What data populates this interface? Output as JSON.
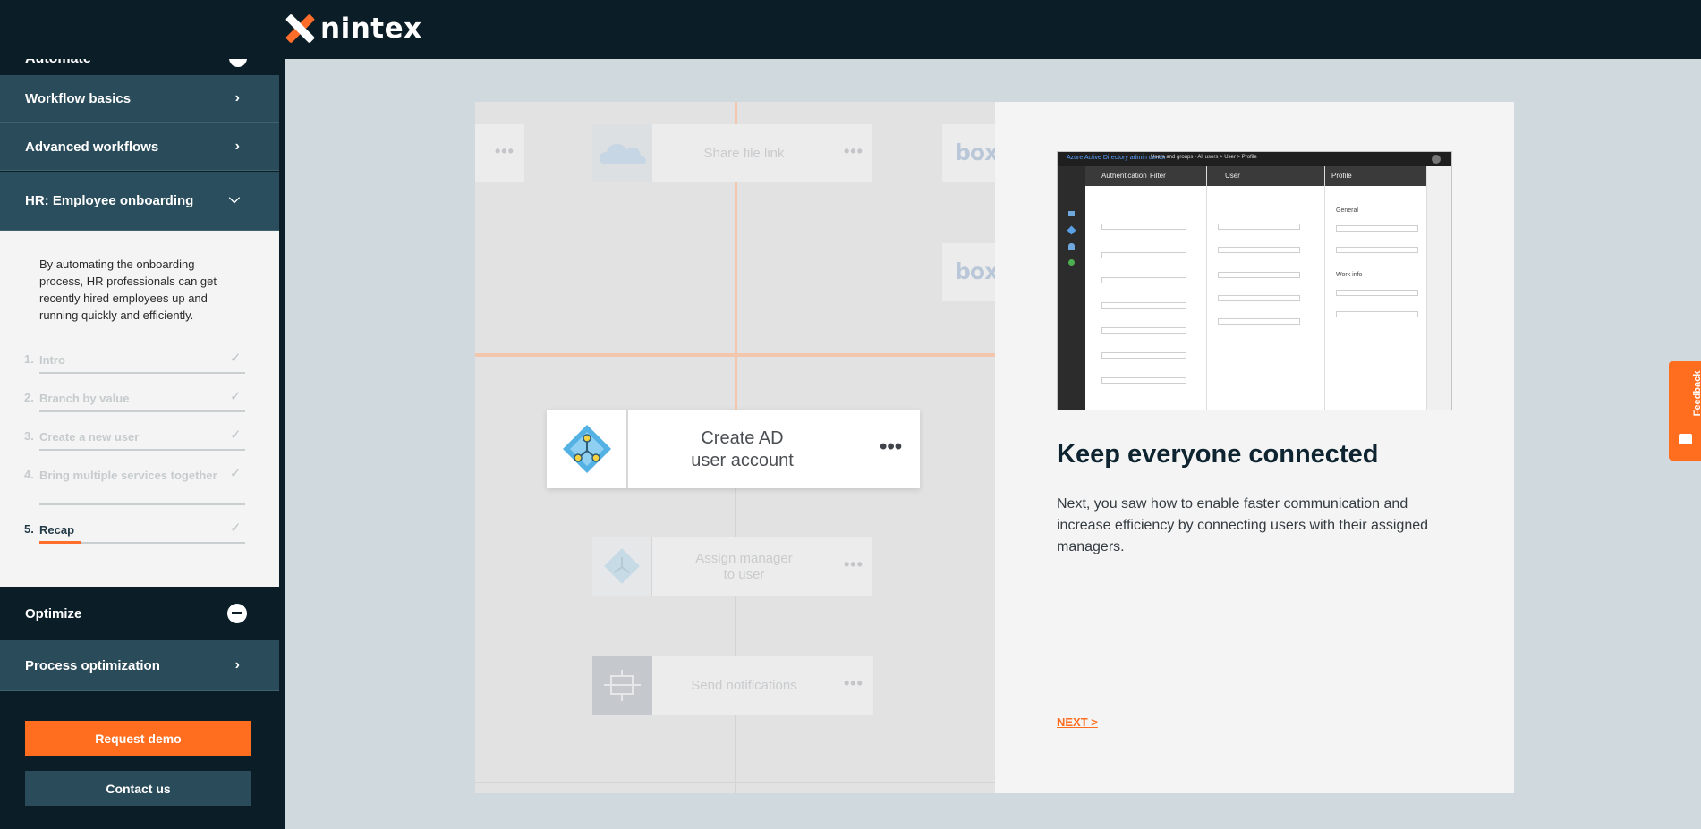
{
  "brand": {
    "name": "nintex",
    "accent": "#ff6d1f",
    "dark": "#0b1e28"
  },
  "sidebar": {
    "peek_label": "Automate",
    "items": [
      {
        "label": "Workflow basics"
      },
      {
        "label": "Advanced workflows"
      },
      {
        "label": "HR: Employee onboarding"
      }
    ],
    "description": "By automating the onboarding process, HR professionals can get recently hired employees up and running quickly and efficiently.",
    "steps": [
      {
        "num": "1.",
        "label": "Intro"
      },
      {
        "num": "2.",
        "label": "Branch by value"
      },
      {
        "num": "3.",
        "label": "Create a new user"
      },
      {
        "num": "4.",
        "label": "Bring multiple services together"
      },
      {
        "num": "5.",
        "label": "Recap"
      }
    ],
    "section_label": "Optimize",
    "sub_item": "Process optimization",
    "request_demo": "Request demo",
    "contact_us": "Contact us"
  },
  "workflow": {
    "share_label": "Share file link",
    "box_label": "box",
    "main_label_1": "Create AD",
    "main_label_2": "user account",
    "assign_label_1": "Assign manager",
    "assign_label_2": "to user",
    "notify_label": "Send notifications"
  },
  "screenshot": {
    "title": "Azure Active Directory admin center",
    "breadcrumb": "Users and groups - All users  >  User  >  Profile",
    "col1": "Authentication",
    "col1b": "Filter",
    "col2": "User",
    "col3": "Profile",
    "general": "General",
    "work_info": "Work info"
  },
  "info": {
    "heading": "Keep everyone connected",
    "body": "Next, you saw how to enable faster communication and increase efficiency by connecting users with their assigned managers.",
    "next": "NEXT >"
  },
  "feedback": {
    "label": "Feedback"
  }
}
